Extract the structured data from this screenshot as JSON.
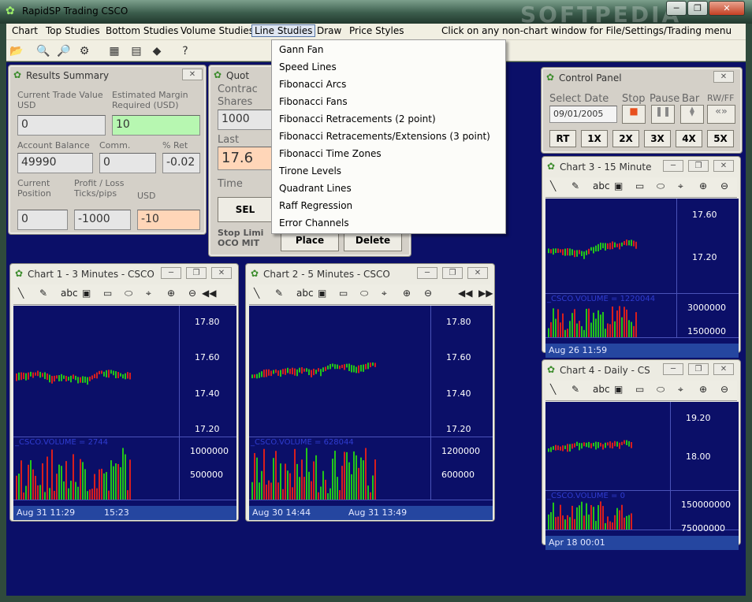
{
  "app": {
    "title": "RapidSP Trading CSCO",
    "window_controls": [
      "minimize-icon",
      "restore-icon",
      "close-icon"
    ],
    "watermark": "SOFTPEDIA"
  },
  "menu": {
    "items": [
      "Chart",
      "Top Studies",
      "Bottom Studies",
      "Volume Studies",
      "Line Studies",
      "Draw",
      "Price Styles"
    ],
    "hint": "Click on any non-chart window for File/Settings/Trading menu",
    "open_menu": "Line Studies"
  },
  "toolbar": {
    "icons": [
      "open-folder-icon",
      "find-icon",
      "print-preview-icon",
      "settings-icon",
      "data-grid-icon",
      "table-icon",
      "card-icon",
      "help-icon"
    ]
  },
  "line_studies_menu": [
    "Gann Fan",
    "Speed Lines",
    "Fibonacci Arcs",
    "Fibonacci Fans",
    "Fibonacci Retracements (2 point)",
    "Fibonacci Retracements/Extensions (3 point)",
    "Fibonacci Time Zones",
    "Tirone Levels",
    "Quadrant Lines",
    "Raff Regression",
    "Error Channels"
  ],
  "results": {
    "title": "Results Summary",
    "labels": {
      "trade_value": "Current Trade Value USD",
      "margin": "Estimated Margin Required (USD)",
      "balance": "Account Balance",
      "comm": "Comm.",
      "ret": "% Ret",
      "position": "Current Position",
      "pl": "Profit / Loss Ticks/pips",
      "usd": "USD"
    },
    "values": {
      "trade_value": "0",
      "margin": "10",
      "balance": "49990",
      "comm": "0",
      "ret": "-0.02",
      "position": "0",
      "ticks": "-1000",
      "usd": "-10"
    }
  },
  "quote": {
    "title": "Quot",
    "contract_label": "Contrac",
    "shares_label": "Shares",
    "shares_value": "1000",
    "last_label": "Last",
    "last_value": "17.6",
    "time_label": "Time",
    "sell_label": "SEL",
    "stop_label": "Stop Limi",
    "oco_label": "OCO MIT",
    "place": "Place",
    "delete": "Delete"
  },
  "control": {
    "title": "Control Panel",
    "select_date": "Select Date",
    "stop": "Stop",
    "pause": "Pause",
    "bar": "Bar",
    "rwff": "RW/FF",
    "date": "09/01/2005",
    "speeds": [
      "RT",
      "1X",
      "2X",
      "3X",
      "4X",
      "5X"
    ]
  },
  "chart_tools": [
    "line-tool-icon",
    "pencil-icon",
    "text-abc-icon",
    "fib-icon",
    "rectangle-icon",
    "ellipse-icon",
    "crosshair-icon",
    "zoom-in-icon",
    "zoom-out-icon"
  ],
  "chart1": {
    "title": "Chart 1 -  3 Minutes - CSCO",
    "prices": [
      "17.80",
      "17.60",
      "17.40",
      "17.20"
    ],
    "vol_label": "_CSCO.VOLUME = 2744",
    "vols": [
      "1000000",
      "500000"
    ],
    "t1": "Aug 31 11:29",
    "t2": "15:23"
  },
  "chart2": {
    "title": "Chart 2 -  5 Minutes - CSCO",
    "prices": [
      "17.80",
      "17.60",
      "17.40",
      "17.20"
    ],
    "vol_label": "_CSCO.VOLUME = 628044",
    "vols": [
      "1200000",
      "600000"
    ],
    "t1": "Aug 30 14:44",
    "t2": "Aug 31 13:49"
  },
  "chart3": {
    "title": "Chart 3 -  15 Minute",
    "prices": [
      "17.60",
      "17.20"
    ],
    "vol_label": "_CSCO.VOLUME = 1220044",
    "vols": [
      "3000000",
      "1500000"
    ],
    "t1": "Aug 26 11:59"
  },
  "chart4": {
    "title": "Chart 4 - Daily - CS",
    "prices": [
      "19.20",
      "18.00"
    ],
    "vol_label": "_CSCO.VOLUME = 0",
    "vols": [
      "150000000",
      "75000000"
    ],
    "t1": "Apr 18 00:01"
  },
  "colors": {
    "up": "#22c51a",
    "down": "#d81e1e",
    "plot_bg": "#0b0f68",
    "grid": "#4a53b8"
  }
}
